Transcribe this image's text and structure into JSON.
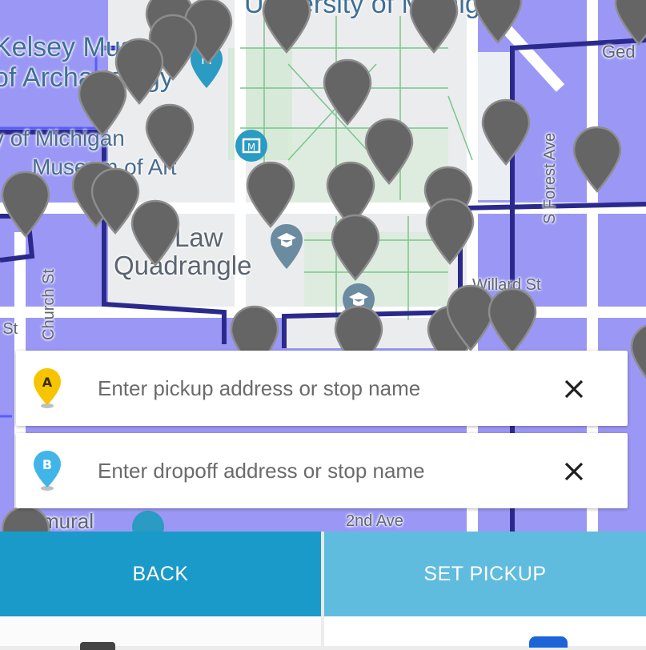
{
  "map": {
    "labels": {
      "university": "University of Michigan",
      "kelsey_1": "Kelsey Museum",
      "kelsey_2": "of Archaeology",
      "moa_1": "University of Michigan",
      "moa_2": "Museum of Art",
      "quad_1": "Law",
      "quad_2": "Quadrangle",
      "geddes": "Ged",
      "willard": "Willard St",
      "forest": "S Forest Ave",
      "church": "Church St",
      "mural": "mural",
      "hill": "Hill St",
      "ave": "2nd Ave"
    }
  },
  "pickup": {
    "marker_letter": "A",
    "placeholder": "Enter pickup address or stop name",
    "clear_symbol": "✕"
  },
  "dropoff": {
    "marker_letter": "B",
    "placeholder": "Enter dropoff address or stop name",
    "clear_symbol": "✕"
  },
  "actions": {
    "back_label": "BACK",
    "set_pickup_label": "SET PICKUP"
  },
  "colors": {
    "back_button": "#1a9ac8",
    "set_pickup_button": "#5fbcdf",
    "service_zone": "#9b98f5",
    "zone_border": "#2b2a8c",
    "stop_pin": "#656565",
    "pickup_marker": "#f6c400",
    "dropoff_marker": "#42b5e8"
  },
  "icons": {
    "stop_pin": "map-pin-icon",
    "museum": "museum-icon",
    "school": "school-icon",
    "clear": "close-icon"
  }
}
